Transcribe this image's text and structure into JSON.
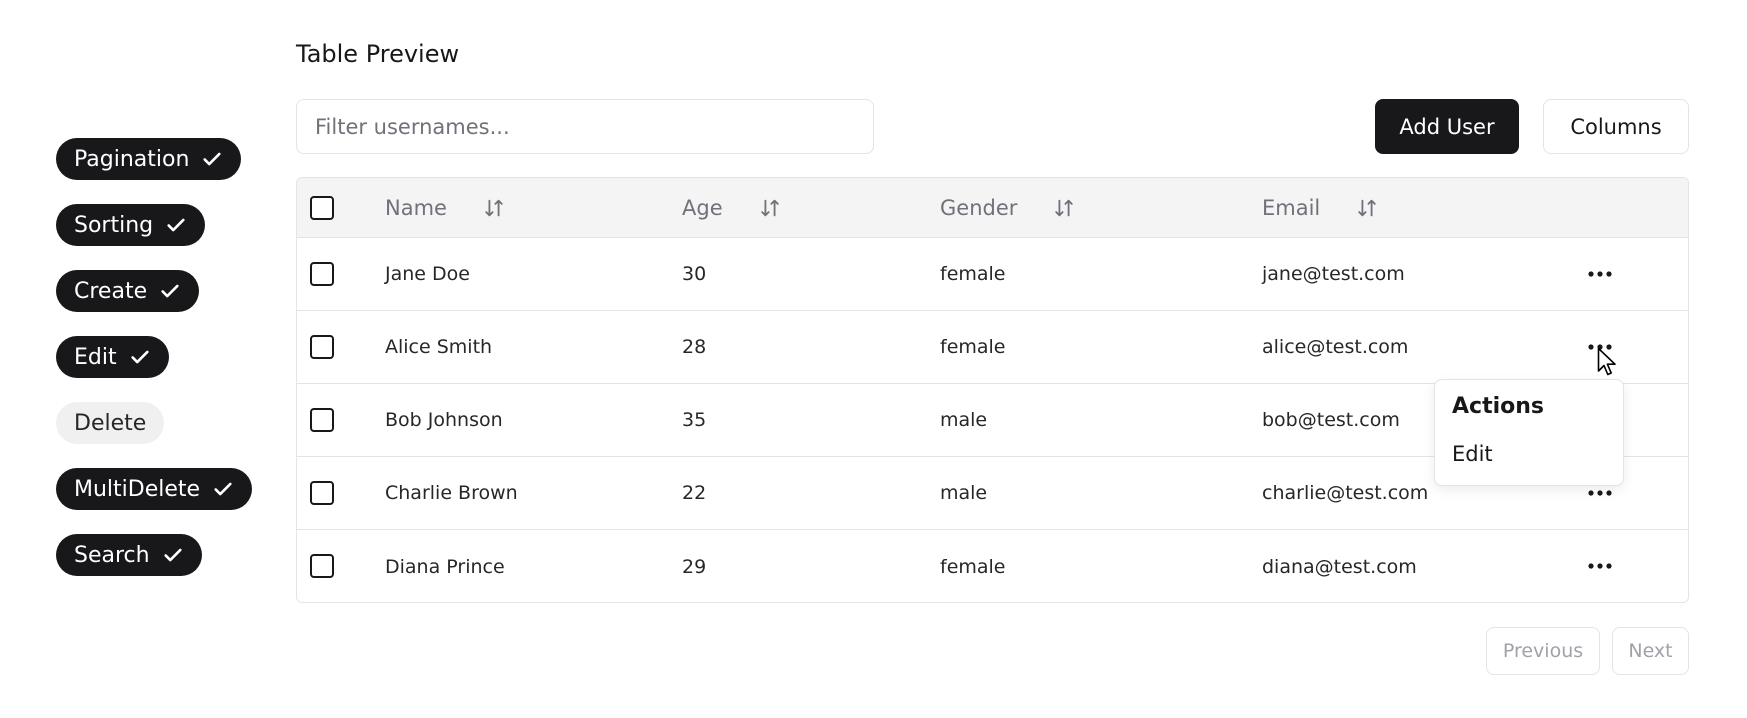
{
  "feature_toggles": [
    {
      "label": "Pagination",
      "enabled": true
    },
    {
      "label": "Sorting",
      "enabled": true
    },
    {
      "label": "Create",
      "enabled": true
    },
    {
      "label": "Edit",
      "enabled": true
    },
    {
      "label": "Delete",
      "enabled": false
    },
    {
      "label": "MultiDelete",
      "enabled": true
    },
    {
      "label": "Search",
      "enabled": true
    }
  ],
  "title": "Table Preview",
  "filter": {
    "placeholder": "Filter usernames...",
    "value": ""
  },
  "toolbar": {
    "add_user_label": "Add User",
    "columns_label": "Columns"
  },
  "table": {
    "columns": [
      "Name",
      "Age",
      "Gender",
      "Email"
    ],
    "rows": [
      {
        "name": "Jane Doe",
        "age": "30",
        "gender": "female",
        "email": "jane@test.com"
      },
      {
        "name": "Alice Smith",
        "age": "28",
        "gender": "female",
        "email": "alice@test.com"
      },
      {
        "name": "Bob Johnson",
        "age": "35",
        "gender": "male",
        "email": "bob@test.com"
      },
      {
        "name": "Charlie Brown",
        "age": "22",
        "gender": "male",
        "email": "charlie@test.com"
      },
      {
        "name": "Diana Prince",
        "age": "29",
        "gender": "female",
        "email": "diana@test.com"
      }
    ]
  },
  "actions_menu": {
    "title": "Actions",
    "items": [
      "Edit"
    ]
  },
  "pagination": {
    "previous_label": "Previous",
    "next_label": "Next"
  },
  "icons": {
    "pill": "check-icon",
    "sort": "sort-arrows-icon",
    "row_action": "more-horizontal-icon"
  }
}
